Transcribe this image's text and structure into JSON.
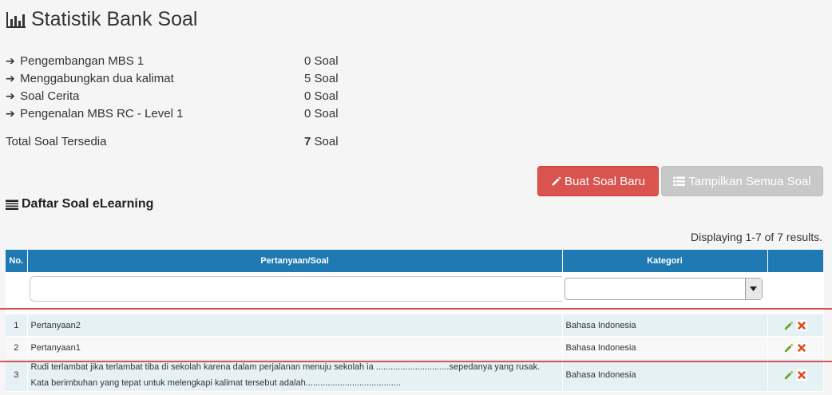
{
  "page_title": "Statistik Bank Soal",
  "stats": [
    {
      "label": "Pengembangan MBS 1",
      "value": "0 Soal"
    },
    {
      "label": "Menggabungkan dua kalimat",
      "value": "5 Soal"
    },
    {
      "label": "Soal Cerita",
      "value": "0 Soal"
    },
    {
      "label": "Pengenalan MBS RC - Level 1",
      "value": "0 Soal"
    }
  ],
  "total": {
    "label": "Total Soal Tersedia",
    "value_number": "7",
    "value_unit": "Soal"
  },
  "buttons": {
    "new_label": "Buat Soal Baru",
    "show_all_label": "Tampilkan Semua Soal"
  },
  "section_title": "Daftar Soal eLearning",
  "summary": "Displaying 1-7 of 7 results.",
  "table": {
    "headers": {
      "no": "No.",
      "question": "Pertanyaan/Soal",
      "category": "Kategori"
    },
    "filter": {
      "question_value": "",
      "category_value": ""
    },
    "rows": [
      {
        "no": "1",
        "question": "Pertanyaan2",
        "category": "Bahasa Indonesia"
      },
      {
        "no": "2",
        "question": "Pertanyaan1",
        "category": "Bahasa Indonesia"
      },
      {
        "no": "3",
        "question_line1": "Rudi terlambat jika terlambat tiba di sekolah karena dalam perjalanan menuju sekolah ia ..............................sepedanya yang rusak.",
        "question_line2": "Kata berimbuhan yang tepat untuk melengkapi kalimat tersebut adalah.......................................",
        "category": "Bahasa Indonesia"
      }
    ]
  },
  "colors": {
    "header_bg": "#1f7ab3",
    "danger": "#d9534f",
    "disabled": "#c8c8c8",
    "row_odd": "#e5f1f4"
  }
}
